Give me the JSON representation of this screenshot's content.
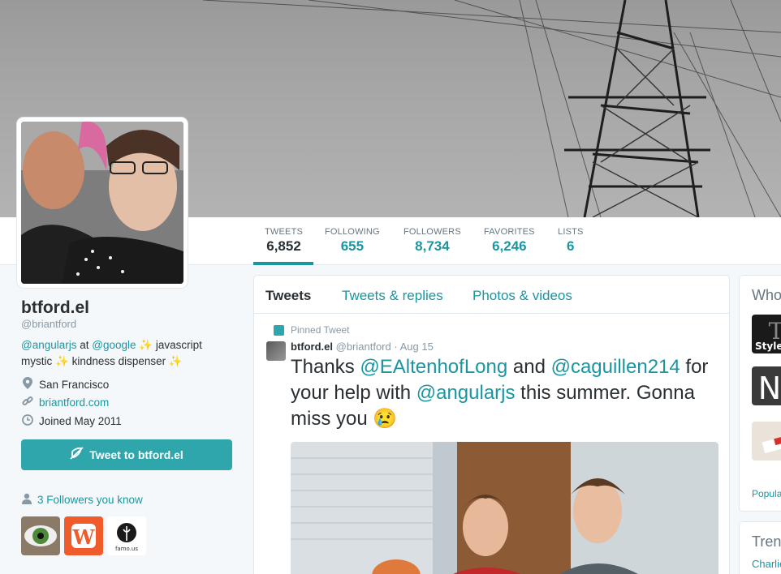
{
  "profile": {
    "name": "btford.el",
    "handle": "@briantford",
    "bio": {
      "mention1": "@angularjs",
      "at": " at ",
      "mention2": "@google",
      "text1": " javascript mystic ",
      "text2": " kindness dispenser ",
      "sparkle": "✨"
    },
    "location": "San Francisco",
    "website": "briantford.com",
    "joined": "Joined May 2011",
    "tweet_to_label": "Tweet to btford.el",
    "followers_you_know": "3 Followers you know"
  },
  "stats": [
    {
      "label": "TWEETS",
      "value": "6,852"
    },
    {
      "label": "FOLLOWING",
      "value": "655"
    },
    {
      "label": "FOLLOWERS",
      "value": "8,734"
    },
    {
      "label": "FAVORITES",
      "value": "6,246"
    },
    {
      "label": "LISTS",
      "value": "6"
    }
  ],
  "timeline": {
    "tabs": [
      "Tweets",
      "Tweets & replies",
      "Photos & videos"
    ],
    "pinned_label": "Pinned Tweet",
    "tweet": {
      "name": "btford.el",
      "handle": "@briantford",
      "date": "· Aug 15",
      "t1": "Thanks ",
      "m1": "@EAltenhofLong",
      "t2": " and ",
      "m2": "@caguillen214",
      "t3": " for your help with ",
      "m3": "@angularjs",
      "t4": " this summer. Gonna miss you ",
      "emoji": "😢"
    }
  },
  "sidebar": {
    "who_title": "Who to follow",
    "thumb1_caption": "Style",
    "thumb2_caption": "N",
    "popular": "Popular accounts",
    "trends_title": "Trends",
    "trend1": "Charlie"
  },
  "colors": {
    "accent": "#1b95a0",
    "button": "#2ea6ab"
  }
}
